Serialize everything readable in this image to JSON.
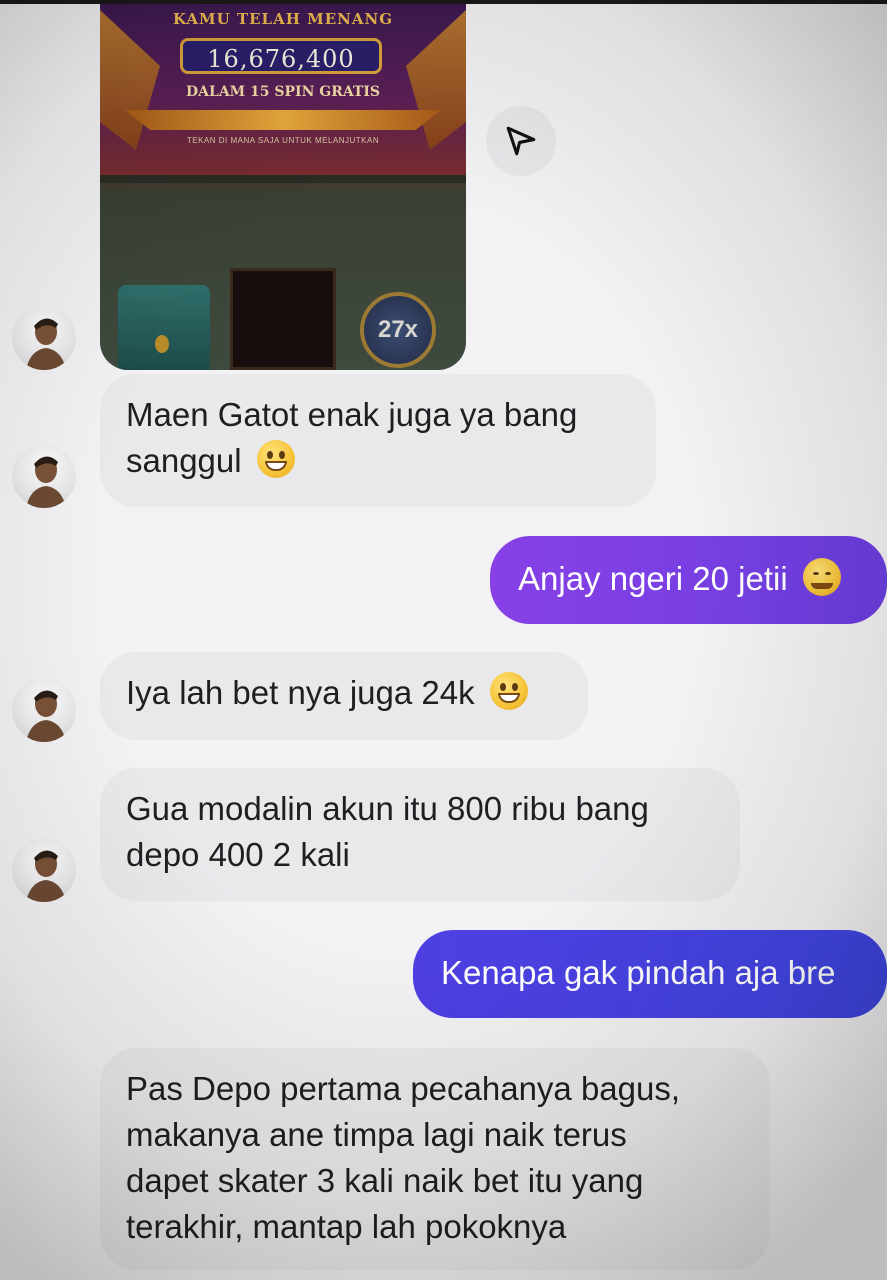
{
  "game_post": {
    "win_title": "KAMU TELAH MENANG",
    "win_amount": "16,676,400",
    "win_subtitle": "DALAM 15 SPIN GRATIS",
    "tap_text": "TEKAN DI MANA SAJA UNTUK MELANJUTKAN",
    "multiplier": "27x"
  },
  "messages": [
    {
      "sender": "contact",
      "lines": [
        "Maen Gatot enak juga ya bang",
        "sanggul"
      ],
      "emoji": "grin-emoji"
    },
    {
      "sender": "me",
      "lines": [
        "Anjay ngeri 20 jetii"
      ],
      "emoji": "drooling-emoji"
    },
    {
      "sender": "contact",
      "lines": [
        "Iya lah bet nya juga 24k"
      ],
      "emoji": "sweat-smile-emoji"
    },
    {
      "sender": "contact",
      "lines": [
        "Gua modalin akun itu 800 ribu bang",
        "depo 400 2 kali"
      ]
    },
    {
      "sender": "me",
      "lines": [
        "Kenapa gak pindah aja bre"
      ]
    },
    {
      "sender": "contact",
      "lines": [
        "Pas Depo pertama pecahanya bagus,",
        "makanya ane timpa lagi naik terus",
        "dapet skater 3 kali naik bet itu yang",
        "terakhir, mantap lah pokoknya"
      ]
    }
  ],
  "colors": {
    "incoming_bubble": "#e9e9ec",
    "outgoing_bubble_1": "#7b3fe0",
    "outgoing_bubble_2": "#4b3fe0"
  },
  "icons": {
    "share": "send-icon",
    "avatar": "contact-avatar"
  }
}
